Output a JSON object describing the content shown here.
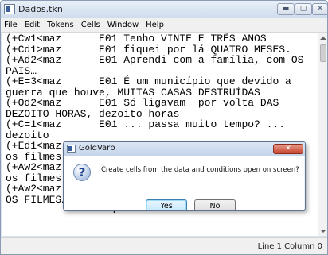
{
  "window": {
    "title": "Dados.tkn",
    "controls": {
      "minimize": "▬",
      "maximize": "▢",
      "close": "✕"
    }
  },
  "menubar": {
    "items": [
      {
        "label": "File"
      },
      {
        "label": "Edit"
      },
      {
        "label": "Tokens"
      },
      {
        "label": "Cells"
      },
      {
        "label": "Window"
      },
      {
        "label": "Help"
      }
    ]
  },
  "editor": {
    "lines": [
      "(+Cw1<maz      E01 Tenho VINTE E TRÊS ANOS",
      "(+Cd1>maz      E01 fiquei por lá QUATRO MESES.",
      "(+Ad2<maz      E01 Aprendi com a família, com OS",
      "PAIS…",
      "(+E=3<maz      E01 É um município que devido a",
      "guerra que houve, MUITAS CASAS DESTRUÍDAS",
      "(+Od2<maz      E01 Só ligavam  por volta DAS",
      "DEZOITO HORAS, dezoito horas",
      "(+C=1<maz      E01 ... passa muito tempo? ...",
      "dezoito",
      "(+Ed1<maz      E01 ...",
      "os filmes",
      "(+Aw2<maz      E01 ...",
      "os filmes",
      "(+Aw2<maz      E01 tão mais ligados às novelas,",
      "OS FILMES…",
      "                 ."
    ]
  },
  "status": {
    "text": "Line 1 Column 0"
  },
  "dialog": {
    "title": "GoldVarb",
    "message": "Create cells from the data and conditions open on screen?",
    "yes_label": "Yes",
    "no_label": "No",
    "close_label": "✕"
  }
}
